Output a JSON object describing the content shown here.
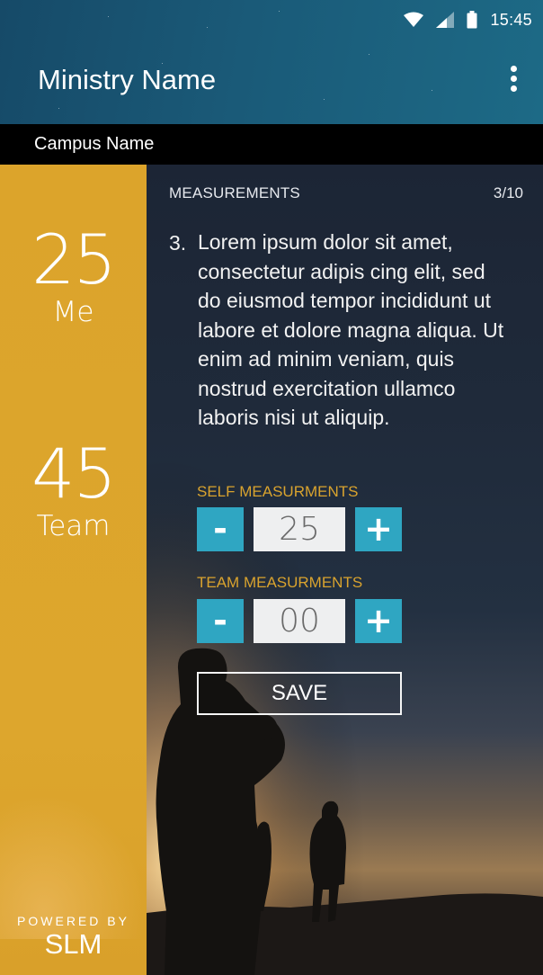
{
  "status": {
    "time": "15:45",
    "icons": [
      "wifi-icon",
      "cellular-signal-icon",
      "battery-icon"
    ]
  },
  "appbar": {
    "title": "Ministry Name",
    "menu_icon": "more-vertical-icon"
  },
  "campus": {
    "name": "Campus Name"
  },
  "sidebar": {
    "me": {
      "value": "25",
      "label": "Me"
    },
    "team": {
      "value": "45",
      "label": "Team"
    },
    "powered_by": "POWERED BY",
    "brand": "SLM"
  },
  "main": {
    "section_label": "MEASUREMENTS",
    "counter": "3/10",
    "question_number": "3.",
    "question_text": "Lorem ipsum dolor sit amet, consectetur adipis cing elit, sed do eiusmod tempor incididunt ut labore et dolore magna aliqua. Ut enim ad minim veniam, quis nostrud exercitation ullamco laboris nisi ut aliquip.",
    "self": {
      "label": "SELF MEASURMENTS",
      "minus": "-",
      "value": "25",
      "plus": "+"
    },
    "team": {
      "label": "TEAM MEASURMENTS",
      "minus": "-",
      "value": "00",
      "plus": "+"
    },
    "save_label": "SAVE"
  },
  "colors": {
    "header_start": "#164a68",
    "header_end": "#1d6a86",
    "campus_bar": "#000000",
    "sidebar": "#dca42b",
    "accent_label": "#d9a32e",
    "stepper_button": "#2fa6c2",
    "stepper_value_bg": "#eeeff0"
  }
}
